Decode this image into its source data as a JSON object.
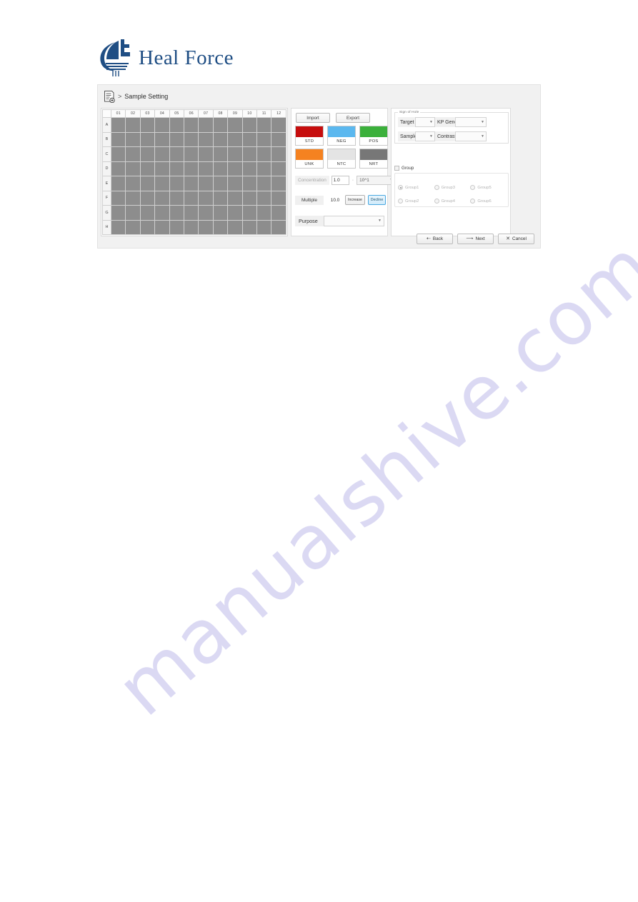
{
  "brand": {
    "name": "Heal Force",
    "logo_icon": "sailboat-logo-icon",
    "color": "#1f4e84"
  },
  "watermark": {
    "text": "manualshive.com",
    "color": "#cfcdf0"
  },
  "breadcrumb": {
    "icon": "document-add-icon",
    "separator": ">",
    "label": "Sample Setting"
  },
  "plate": {
    "columns": [
      "01",
      "02",
      "03",
      "04",
      "05",
      "06",
      "07",
      "08",
      "09",
      "10",
      "11",
      "12"
    ],
    "rows": [
      "A",
      "B",
      "C",
      "D",
      "E",
      "F",
      "G",
      "H"
    ],
    "well_color": "#8d8d8d"
  },
  "middle": {
    "import_label": "Import",
    "export_label": "Export",
    "swatches": [
      {
        "label": "STD",
        "color": "#c60d0d"
      },
      {
        "label": "NEG",
        "color": "#5bb8ef"
      },
      {
        "label": "POS",
        "color": "#3bb03b"
      },
      {
        "label": "UNK",
        "color": "#f58220"
      },
      {
        "label": "NTC",
        "color": "#e4e4e4"
      },
      {
        "label": "NRT",
        "color": "#777777"
      }
    ],
    "concentration": {
      "label": "Concentration",
      "value": "1.0",
      "operator": "·",
      "exponent": "10^1"
    },
    "multiple": {
      "label": "Multiple",
      "value": "10.0",
      "increase_label": "Increase",
      "decline_label": "Decline",
      "accent_color": "#49a8e0"
    },
    "purpose": {
      "label": "Purpose",
      "value": ""
    }
  },
  "sign_of_hole": {
    "title": "Sign of Hole",
    "target_label": "Target",
    "target_value": "",
    "kp_gene_label": "KP Gene",
    "kp_gene_value": "",
    "sample_label": "Sample",
    "sample_value": "",
    "contrast_label": "Contrast",
    "contrast_value": ""
  },
  "group": {
    "checkbox_label": "Group",
    "checked": false,
    "selected": "Group1",
    "options": [
      "Group1",
      "Group3",
      "Group5",
      "Group2",
      "Group4",
      "Group6"
    ]
  },
  "footer": {
    "back_label": "Back",
    "back_icon": "arrow-back-icon",
    "next_label": "Next",
    "next_icon": "arrow-right-icon",
    "cancel_label": "Cancel",
    "cancel_icon": "close-x-icon"
  }
}
